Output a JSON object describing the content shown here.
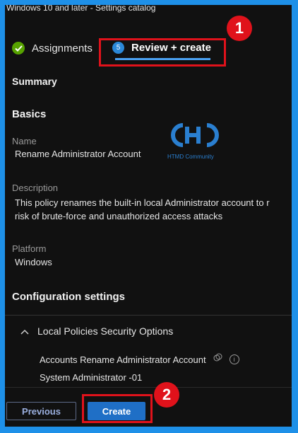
{
  "breadcrumb": "Windows 10 and later - Settings catalog",
  "tabs": {
    "assignments": "Assignments",
    "review_step": "5",
    "review": "Review + create"
  },
  "summary_heading": "Summary",
  "basics": {
    "heading": "Basics",
    "name_label": "Name",
    "name_value": "Rename Administrator Account",
    "description_label": "Description",
    "description_line1": "This policy renames the built-in local Administrator account to r",
    "description_line2": "risk of brute-force and unauthorized access attacks",
    "platform_label": "Platform",
    "platform_value": "Windows"
  },
  "configuration": {
    "heading": "Configuration settings",
    "section": "Local Policies Security Options",
    "setting_name": "Accounts Rename Administrator Account",
    "setting_value": "System Administrator -01"
  },
  "footer": {
    "previous": "Previous",
    "create": "Create"
  },
  "callouts": {
    "one": "1",
    "two": "2"
  },
  "watermark": {
    "caption": "HTMD Community"
  },
  "colors": {
    "frame_border": "#1e90e8",
    "callout": "#e0121b",
    "primary_button": "#1f6fc6",
    "success": "#57a300"
  }
}
